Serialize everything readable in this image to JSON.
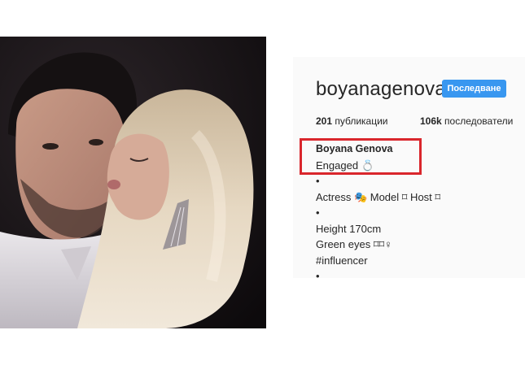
{
  "profile": {
    "username": "boyanagenova",
    "follow_label": "Последване",
    "posts_count": "201",
    "posts_label": "публикации",
    "followers_count": "106k",
    "followers_label": "последователи",
    "full_name": "Boyana Genova",
    "bio_lines": [
      "Engaged 💍",
      "•",
      "Actress 🎭 Model ⌑ Host ⌑",
      "•",
      "Height 170cm",
      "Green eyes ⌑⌑♀",
      "#influencer",
      "•"
    ]
  },
  "colors": {
    "accent": "#3897f0",
    "highlight": "#d9262c",
    "panel_bg": "#fafafa"
  }
}
